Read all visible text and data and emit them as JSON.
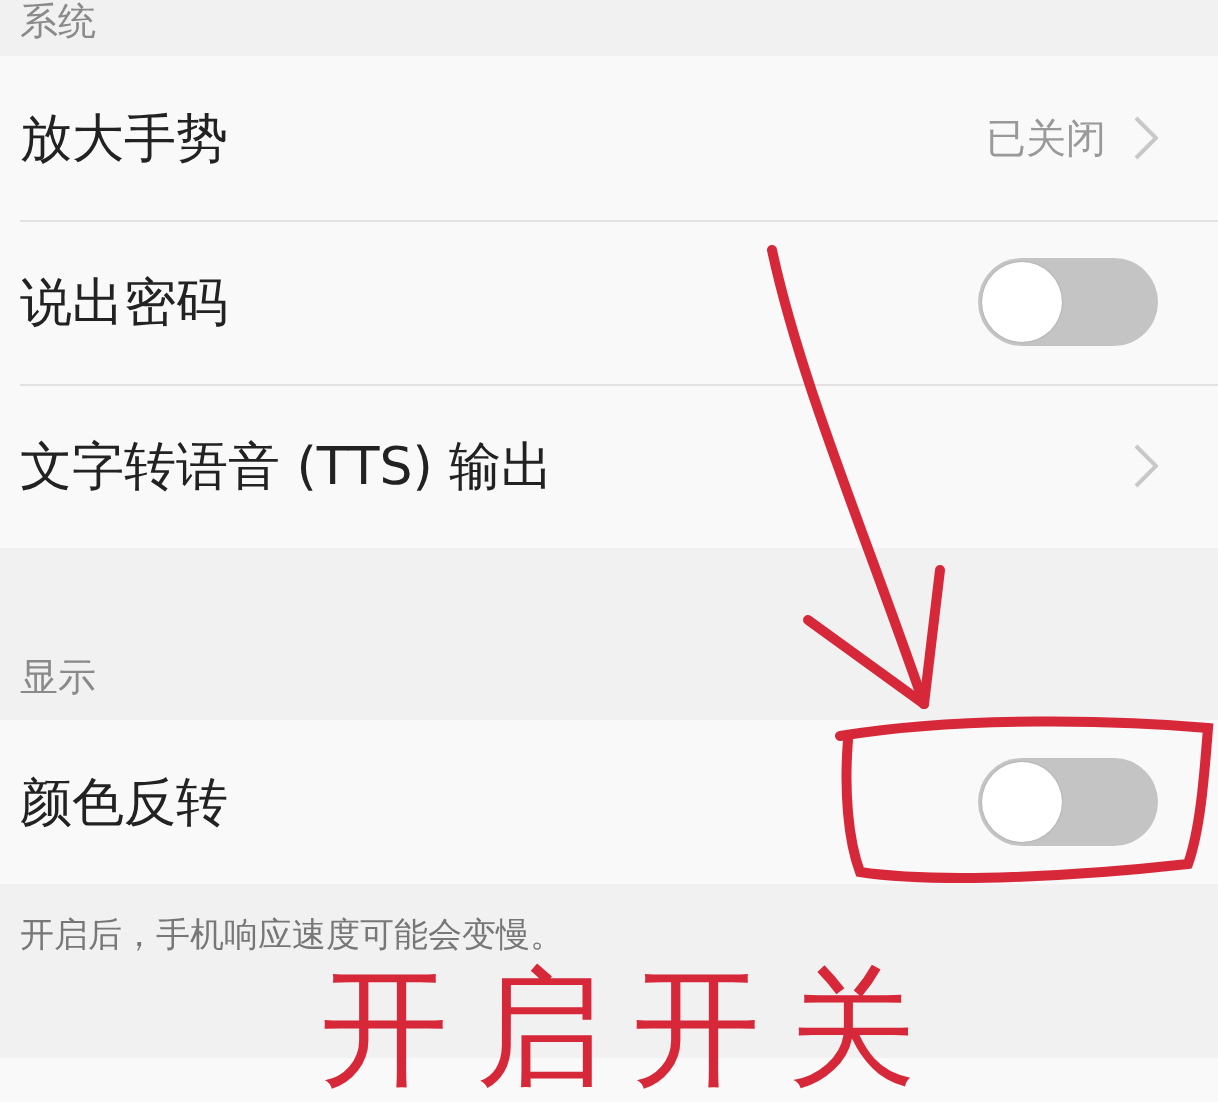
{
  "sections": [
    {
      "header": "系统",
      "rows": [
        {
          "kind": "link",
          "label": "放大手势",
          "value": "已关闭"
        },
        {
          "kind": "toggle",
          "label": "说出密码",
          "on": false
        },
        {
          "kind": "link",
          "label": "文字转语音 (TTS) 输出"
        }
      ]
    },
    {
      "header": "显示",
      "rows": [
        {
          "kind": "toggle",
          "label": "颜色反转",
          "on": false
        }
      ],
      "note": "开启后，手机响应速度可能会变慢。"
    }
  ],
  "annotation": {
    "text": "开启开关"
  }
}
